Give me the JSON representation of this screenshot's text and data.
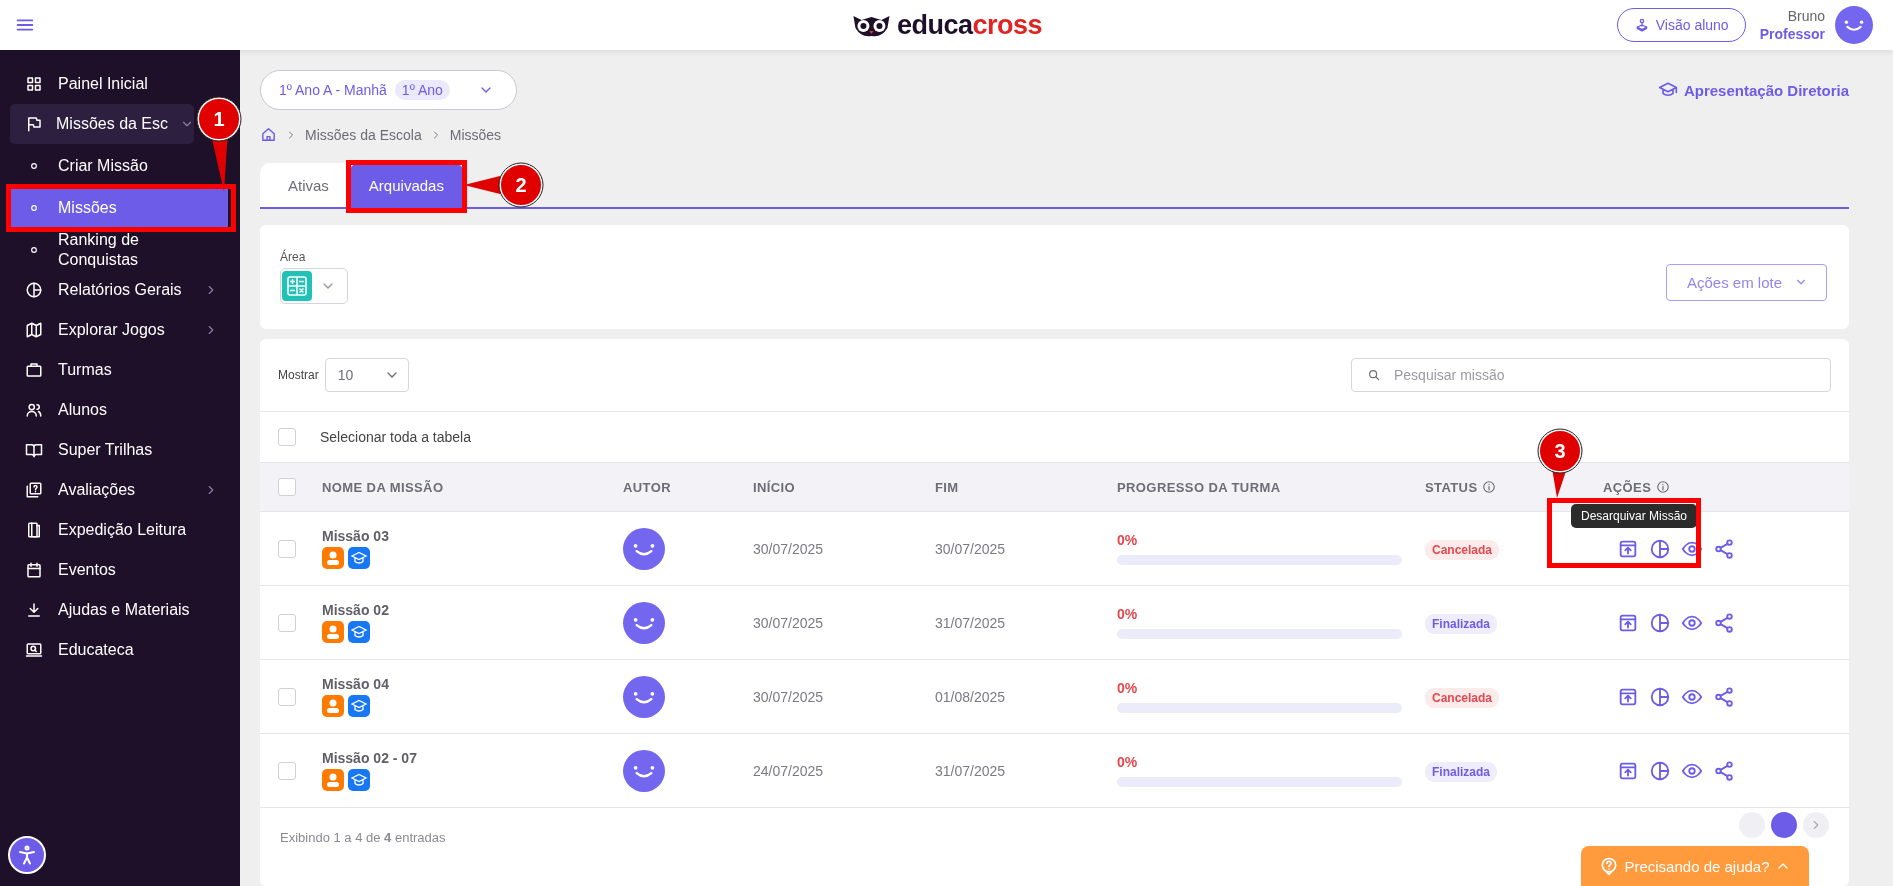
{
  "topbar": {
    "logo": {
      "text_1": "educa",
      "text_2": "cross"
    },
    "student_view_button": "Visão aluno",
    "user": {
      "name": "Bruno",
      "role": "Professor"
    }
  },
  "sidebar": {
    "items": [
      {
        "label": "Painel Inicial",
        "selected": false
      },
      {
        "label": "Missões da Esc",
        "selected": false,
        "expanded": true,
        "children": [
          {
            "label": "Criar Missão",
            "selected": false
          },
          {
            "label": "Missões",
            "selected": true,
            "callout": "1"
          },
          {
            "label": "Ranking de Conquistas",
            "selected": false
          }
        ]
      },
      {
        "label": "Relatórios Gerais",
        "selected": false,
        "expanded": false
      },
      {
        "label": "Explorar Jogos",
        "selected": false,
        "expanded": false
      },
      {
        "label": "Turmas",
        "selected": false
      },
      {
        "label": "Alunos",
        "selected": false
      },
      {
        "label": "Super Trilhas",
        "selected": false
      },
      {
        "label": "Avaliações",
        "selected": false,
        "expanded": false
      },
      {
        "label": "Expedição Leitura",
        "selected": false
      },
      {
        "label": "Eventos",
        "selected": false
      },
      {
        "label": "Ajudas e Materiais",
        "selected": false
      },
      {
        "label": "Educateca",
        "selected": false
      }
    ]
  },
  "class_selector": {
    "label": "1º Ano A - Manhã",
    "badge": "1º Ano"
  },
  "presentation_link": "Apresentação Diretoria",
  "breadcrumb": [
    "Missões da Escola",
    "Missões"
  ],
  "tabs": [
    {
      "label": "Ativas",
      "selected": false
    },
    {
      "label": "Arquivadas",
      "selected": true,
      "callout": "2"
    }
  ],
  "filters": {
    "area_label": "Área",
    "bulk_actions": "Ações em lote"
  },
  "table": {
    "show_label": "Mostrar",
    "page_size": "10",
    "search": {
      "placeholder": "Pesquisar missão"
    },
    "select_all": {
      "label": "Selecionar toda a tabela",
      "checked": false
    },
    "header_checkbox": {
      "checked": false
    },
    "columns": [
      {
        "label": "NOME DA MISSÃO",
        "info": false
      },
      {
        "label": "AUTOR",
        "info": false
      },
      {
        "label": "INÍCIO",
        "info": false
      },
      {
        "label": "FIM",
        "info": false
      },
      {
        "label": "PROGRESSO DA TURMA",
        "info": false
      },
      {
        "label": "STATUS",
        "info": true
      },
      {
        "label": "AÇÕES",
        "info": true
      }
    ],
    "rows": [
      {
        "checked": false,
        "name": "Missão 03",
        "start": "30/07/2025",
        "end": "30/07/2025",
        "progress": {
          "text": "0%",
          "level": 0
        },
        "status": {
          "label": "Cancelada",
          "color": "#e5484d"
        },
        "tooltip": "Desarquivar Missão",
        "callout": "3"
      },
      {
        "checked": false,
        "name": "Missão 02",
        "start": "30/07/2025",
        "end": "31/07/2025",
        "progress": {
          "text": "0%",
          "level": 0
        },
        "status": {
          "label": "Finalizada",
          "color": "#6c5ce7"
        }
      },
      {
        "checked": false,
        "name": "Missão 04",
        "start": "30/07/2025",
        "end": "01/08/2025",
        "progress": {
          "text": "0%",
          "level": 0
        },
        "status": {
          "label": "Cancelada",
          "color": "#e5484d"
        }
      },
      {
        "checked": false,
        "name": "Missão 02 - 07",
        "start": "24/07/2025",
        "end": "31/07/2025",
        "progress": {
          "text": "0%",
          "level": 0
        },
        "status": {
          "label": "Finalizada",
          "color": "#6c5ce7"
        }
      }
    ],
    "footer": "Exibindo 1 a 4 de **4** entradas"
  },
  "help_button": "Precisando de ajuda?"
}
